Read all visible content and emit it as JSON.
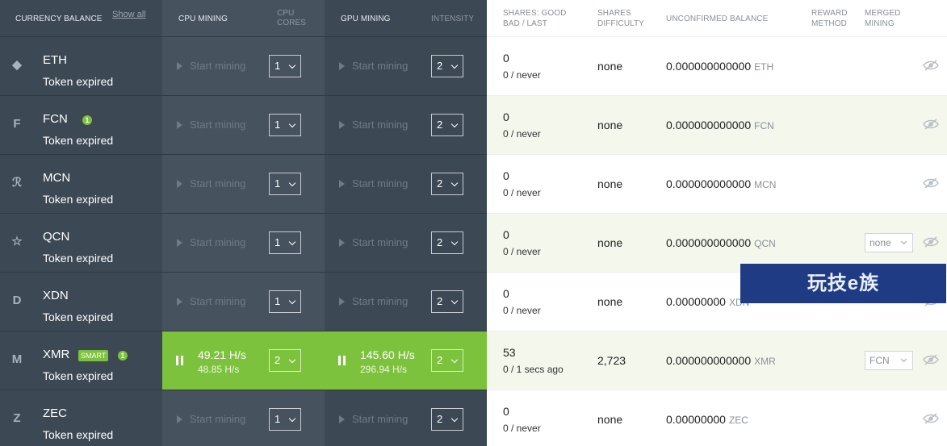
{
  "headers": {
    "currency_balance": "CURRENCY BALANCE",
    "show_all": "Show all",
    "cpu_mining": "CPU MINING",
    "cpu_cores": "CPU\nCORES",
    "gpu_mining": "GPU MINING",
    "intensity": "INTENSITY",
    "shares_good": "SHARES: GOOD\nBAD / LAST",
    "shares_difficulty": "SHARES\nDIFFICULTY",
    "unconfirmed_balance": "UNCONFIRMED BALANCE",
    "reward_method": "REWARD\nMETHOD",
    "merged_mining": "MERGED\nMINING"
  },
  "rows": [
    {
      "icon": "ethereum-icon",
      "glyph": "◆",
      "name": "ETH",
      "sub": "Token expired",
      "cpu_cores": "1",
      "intensity": "2",
      "start_label": "Start mining",
      "good": "0",
      "bad_last": "0 / never",
      "difficulty": "none",
      "balance": "0.000000000000",
      "balance_cur": "ETH"
    },
    {
      "icon": "fcn-icon",
      "glyph": "F",
      "name": "FCN",
      "badge": "1",
      "sub": "Token expired",
      "cpu_cores": "1",
      "intensity": "2",
      "start_label": "Start mining",
      "good": "0",
      "bad_last": "0 / never",
      "difficulty": "none",
      "balance": "0.000000000000",
      "balance_cur": "FCN"
    },
    {
      "icon": "mcn-icon",
      "glyph": "ℛ",
      "name": "MCN",
      "sub": "Token expired",
      "cpu_cores": "1",
      "intensity": "2",
      "start_label": "Start mining",
      "good": "0",
      "bad_last": "0 / never",
      "difficulty": "none",
      "balance": "0.000000000000",
      "balance_cur": "MCN"
    },
    {
      "icon": "star-icon",
      "glyph": "☆",
      "name": "QCN",
      "sub": "Token expired",
      "cpu_cores": "1",
      "intensity": "2",
      "start_label": "Start mining",
      "good": "0",
      "bad_last": "0 / never",
      "difficulty": "none",
      "balance": "0.000000000000",
      "balance_cur": "QCN",
      "merged": "none"
    },
    {
      "icon": "xdn-icon",
      "glyph": "D",
      "name": "XDN",
      "sub": "Token expired",
      "cpu_cores": "1",
      "intensity": "2",
      "start_label": "Start mining",
      "good": "0",
      "bad_last": "0 / never",
      "difficulty": "none",
      "balance": "0.00000000",
      "balance_cur": "XDN"
    },
    {
      "icon": "monero-icon",
      "glyph": "M",
      "name": "XMR",
      "smart": "SMART",
      "badge": "1",
      "sub": "Token expired",
      "cpu_cores": "2",
      "intensity": "2",
      "active": true,
      "cpu_rate": "49.21 H/s",
      "cpu_rate2": "48.85 H/s",
      "gpu_rate": "145.60 H/s",
      "gpu_rate2": "296.94 H/s",
      "good": "53",
      "bad_last": "0 / 1 secs ago",
      "difficulty": "2,723",
      "balance": "0.000000000000",
      "balance_cur": "XMR",
      "merged": "FCN"
    },
    {
      "icon": "zcash-icon",
      "glyph": "Z",
      "name": "ZEC",
      "sub": "Token expired",
      "cpu_cores": "1",
      "intensity": "2",
      "start_label": "Start mining",
      "good": "0",
      "bad_last": "0 / never",
      "difficulty": "none",
      "balance": "0.00000000",
      "balance_cur": "ZEC"
    }
  ],
  "watermark": "玩技e族",
  "colors": {
    "accent": "#7dc23d",
    "sidebar": "#3c4853",
    "alt_row": "#f3f7ec"
  }
}
